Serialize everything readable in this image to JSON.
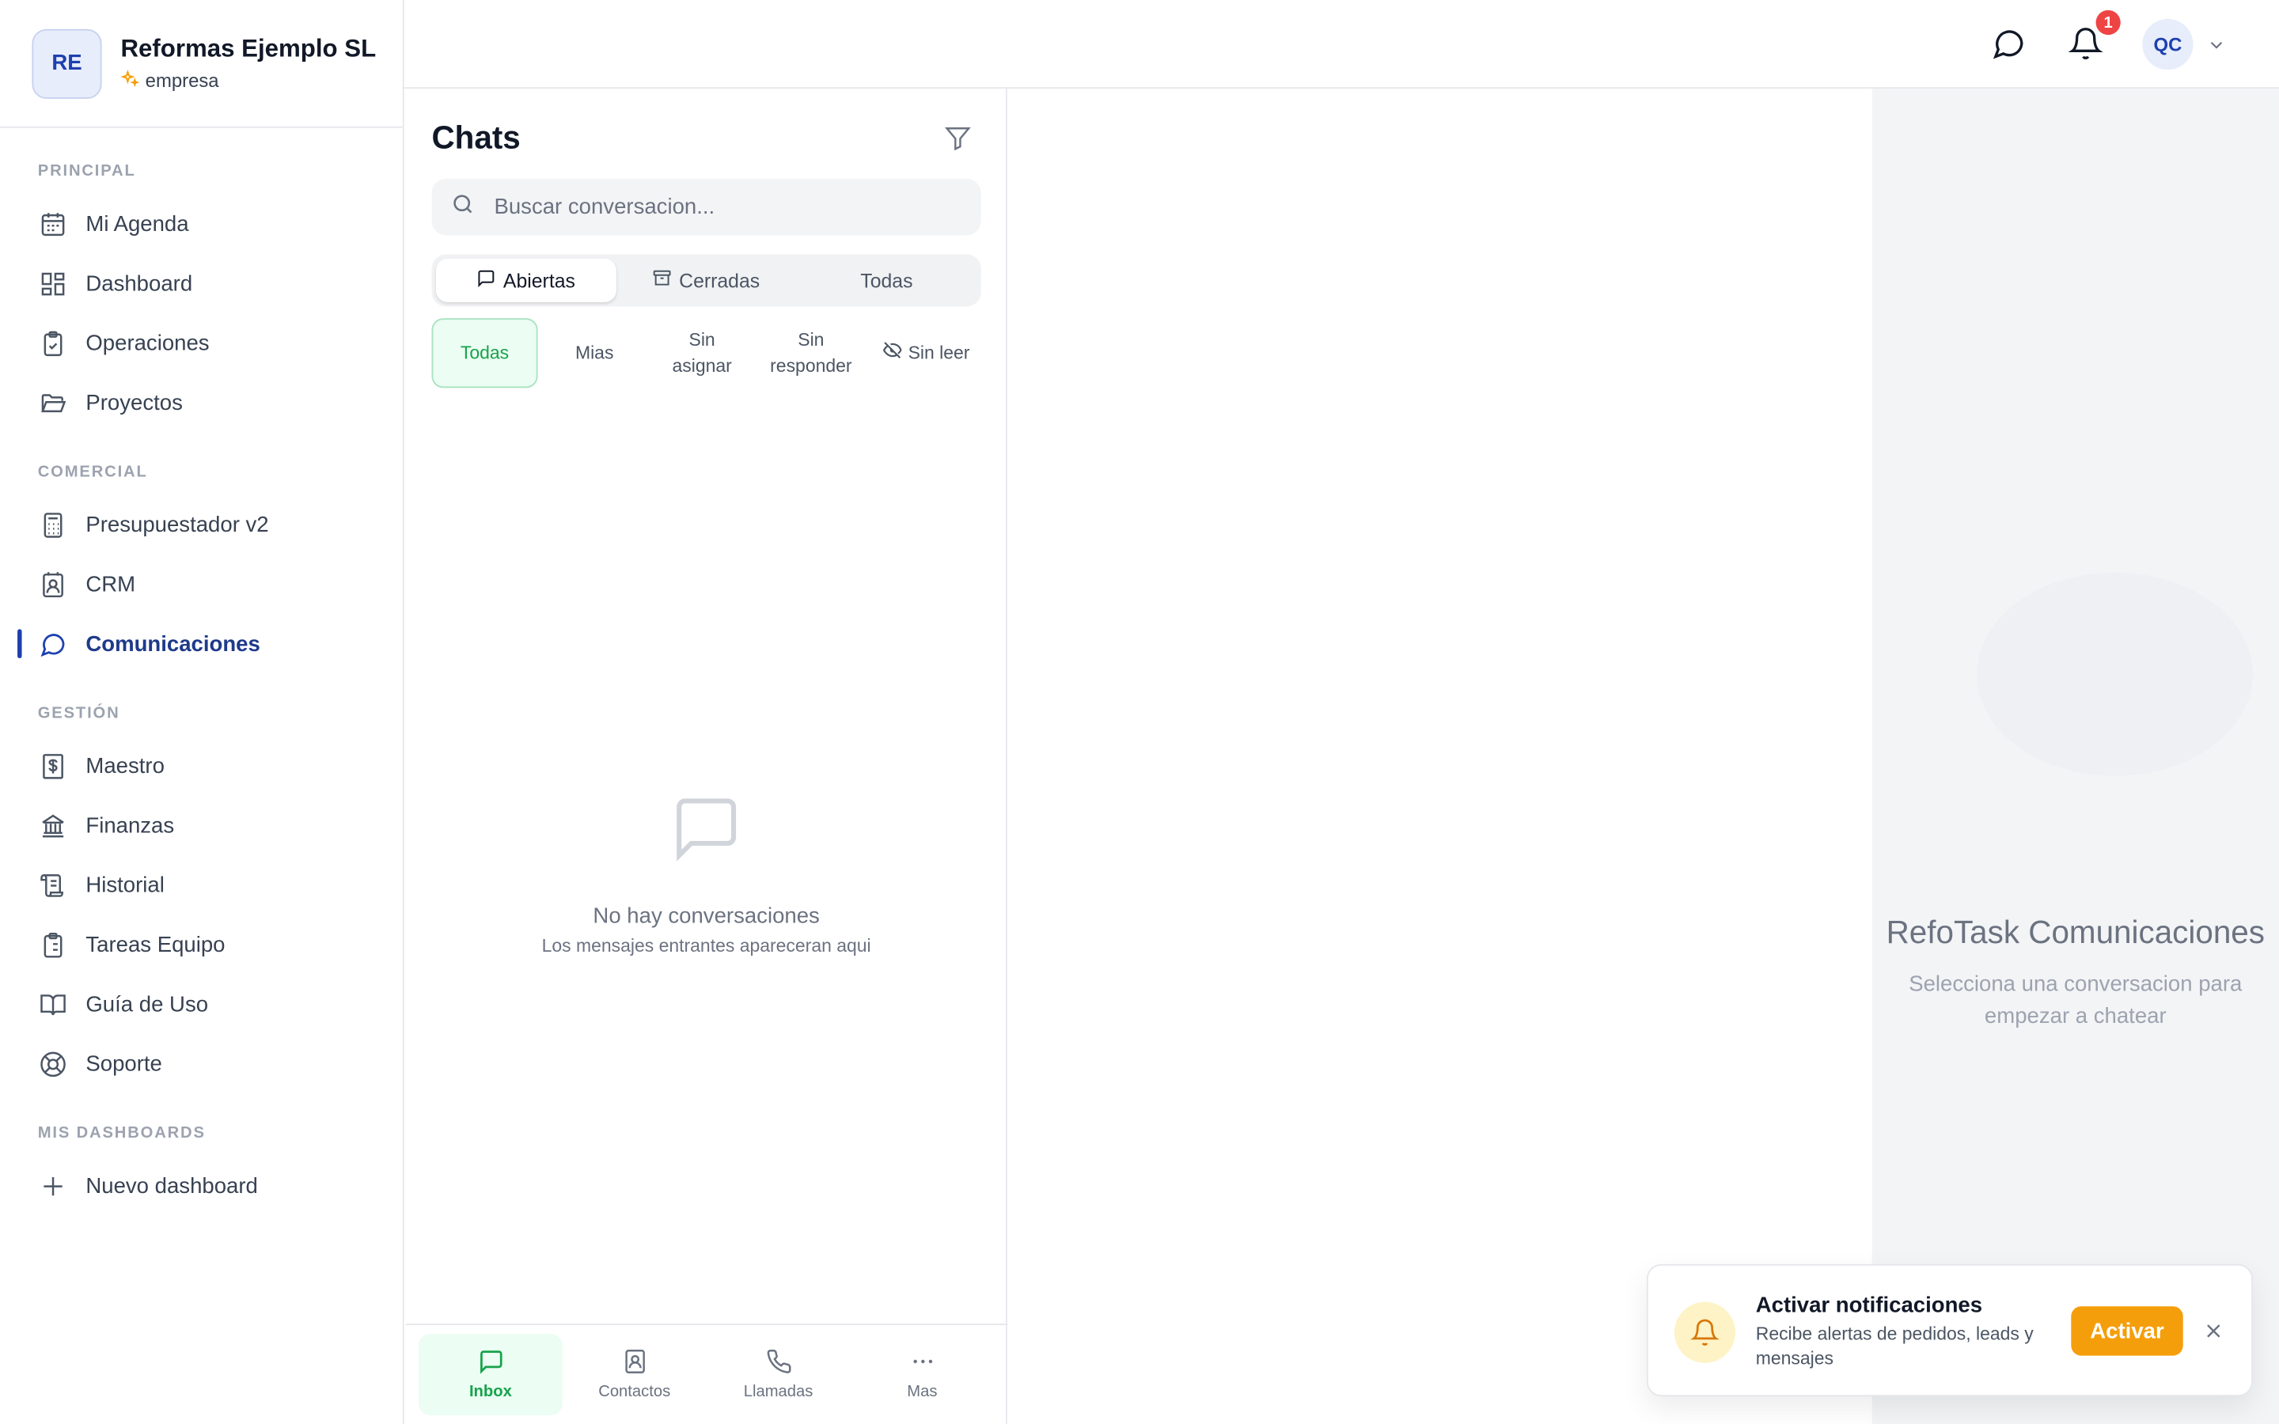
{
  "brand": {
    "initials": "RE",
    "name": "Reformas Ejemplo SL",
    "plan": "empresa"
  },
  "sidebar": {
    "sections": [
      {
        "title": "PRINCIPAL",
        "items": [
          {
            "label": "Mi Agenda",
            "icon": "calendar-icon"
          },
          {
            "label": "Dashboard",
            "icon": "dashboard-icon"
          },
          {
            "label": "Operaciones",
            "icon": "clipboard-check-icon"
          },
          {
            "label": "Proyectos",
            "icon": "folder-open-icon"
          }
        ]
      },
      {
        "title": "COMERCIAL",
        "items": [
          {
            "label": "Presupuestador v2",
            "icon": "calculator-icon"
          },
          {
            "label": "CRM",
            "icon": "contact-icon"
          },
          {
            "label": "Comunicaciones",
            "icon": "chat-bubble-icon",
            "active": true
          }
        ]
      },
      {
        "title": "GESTIÓN",
        "items": [
          {
            "label": "Maestro",
            "icon": "dollar-doc-icon"
          },
          {
            "label": "Finanzas",
            "icon": "bank-icon"
          },
          {
            "label": "Historial",
            "icon": "scroll-icon"
          },
          {
            "label": "Tareas Equipo",
            "icon": "clipboard-list-icon"
          },
          {
            "label": "Guía de Uso",
            "icon": "book-icon"
          },
          {
            "label": "Soporte",
            "icon": "life-buoy-icon"
          }
        ]
      },
      {
        "title": "MIS DASHBOARDS",
        "items": [
          {
            "label": "Nuevo dashboard",
            "icon": "plus-icon"
          }
        ]
      }
    ]
  },
  "topbar": {
    "notification_count": "1",
    "user_initials": "QC"
  },
  "chats": {
    "title": "Chats",
    "search_placeholder": "Buscar conversacion...",
    "tabs": {
      "open": "Abiertas",
      "closed": "Cerradas",
      "all": "Todas"
    },
    "filters": {
      "all": "Todas",
      "mine": "Mias",
      "unassigned_1": "Sin",
      "unassigned_2": "asignar",
      "unanswered_1": "Sin",
      "unanswered_2": "responder",
      "unread": "Sin leer"
    },
    "empty_title": "No hay conversaciones",
    "empty_sub": "Los mensajes entrantes apareceran aqui",
    "bottom_nav": {
      "inbox": "Inbox",
      "contacts": "Contactos",
      "calls": "Llamadas",
      "more": "Mas"
    }
  },
  "right_panel": {
    "title": "RefoTask Comunicaciones",
    "subtitle": "Selecciona una conversacion para empezar a chatear"
  },
  "toast": {
    "title": "Activar notificaciones",
    "message": "Recibe alertas de pedidos, leads y mensajes",
    "button": "Activar"
  },
  "colors": {
    "accent": "#1e40af",
    "green": "#16a34a",
    "orange": "#f59e0b",
    "badge": "#ef4444"
  }
}
